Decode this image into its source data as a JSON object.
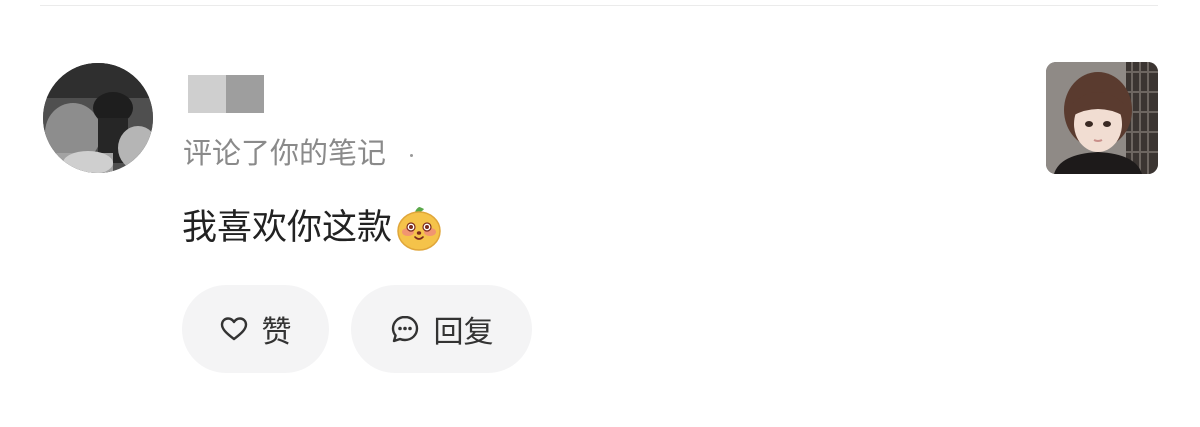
{
  "notification": {
    "action_text": "评论了你的笔记",
    "comment_text": "我喜欢你这款",
    "emoji_name": "orange-face-emoji",
    "actions": {
      "like_label": "赞",
      "reply_label": "回复"
    }
  },
  "icons": {
    "like": "heart-outline-icon",
    "reply": "chat-bubble-icon"
  },
  "colors": {
    "pill_background": "#f4f4f5",
    "secondary_text": "#8a8a8a",
    "primary_text": "#222222",
    "emoji_body": "#f5c34a"
  }
}
